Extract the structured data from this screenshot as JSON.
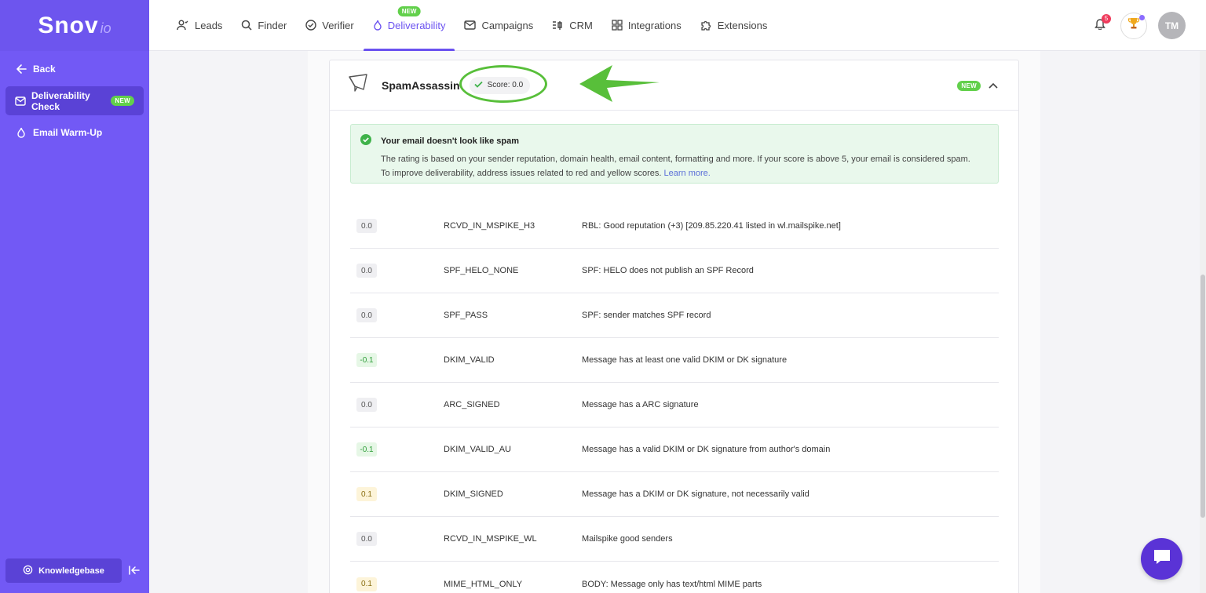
{
  "brand": {
    "main": "Snov",
    "sub": "io"
  },
  "sidebar": {
    "back": "Back",
    "items": [
      {
        "label": "Deliverability Check",
        "badge": "NEW"
      },
      {
        "label": "Email Warm-Up"
      }
    ],
    "knowledgebase": "Knowledgebase"
  },
  "nav": {
    "items": [
      {
        "label": "Leads",
        "icon": "users-icon"
      },
      {
        "label": "Finder",
        "icon": "search-icon"
      },
      {
        "label": "Verifier",
        "icon": "check-circle-icon"
      },
      {
        "label": "Deliverability",
        "icon": "flame-icon",
        "tag": "NEW"
      },
      {
        "label": "Campaigns",
        "icon": "mail-icon"
      },
      {
        "label": "CRM",
        "icon": "crm-icon"
      },
      {
        "label": "Integrations",
        "icon": "grid-icon"
      },
      {
        "label": "Extensions",
        "icon": "puzzle-icon"
      }
    ],
    "notifications": "5",
    "avatar": "TM"
  },
  "card": {
    "title": "SpamAssassin",
    "score": "Score: 0.0",
    "badge": "NEW",
    "alert": {
      "title": "Your email doesn't look like spam",
      "body": "The rating is based on your sender reputation, domain health, email content, formatting and more. If your score is above 5, your email is considered spam.",
      "body2": "To improve deliverability, address issues related to red and yellow scores.",
      "link": "Learn more."
    },
    "rows": [
      {
        "score": "0.0",
        "kind": "neutral",
        "rule": "RCVD_IN_MSPIKE_H3",
        "desc": "RBL: Good reputation (+3) [209.85.220.41 listed in wl.mailspike.net]"
      },
      {
        "score": "0.0",
        "kind": "neutral",
        "rule": "SPF_HELO_NONE",
        "desc": "SPF: HELO does not publish an SPF Record"
      },
      {
        "score": "0.0",
        "kind": "neutral",
        "rule": "SPF_PASS",
        "desc": "SPF: sender matches SPF record"
      },
      {
        "score": "-0.1",
        "kind": "neg",
        "rule": "DKIM_VALID",
        "desc": "Message has at least one valid DKIM or DK signature"
      },
      {
        "score": "0.0",
        "kind": "neutral",
        "rule": "ARC_SIGNED",
        "desc": "Message has a ARC signature"
      },
      {
        "score": "-0.1",
        "kind": "neg",
        "rule": "DKIM_VALID_AU",
        "desc": "Message has a valid DKIM or DK signature from author's domain"
      },
      {
        "score": "0.1",
        "kind": "pos",
        "rule": "DKIM_SIGNED",
        "desc": "Message has a DKIM or DK signature, not necessarily valid"
      },
      {
        "score": "0.0",
        "kind": "neutral",
        "rule": "RCVD_IN_MSPIKE_WL",
        "desc": "Mailspike good senders"
      },
      {
        "score": "0.1",
        "kind": "pos",
        "rule": "MIME_HTML_ONLY",
        "desc": "BODY: Message only has text/html MIME parts"
      }
    ]
  }
}
